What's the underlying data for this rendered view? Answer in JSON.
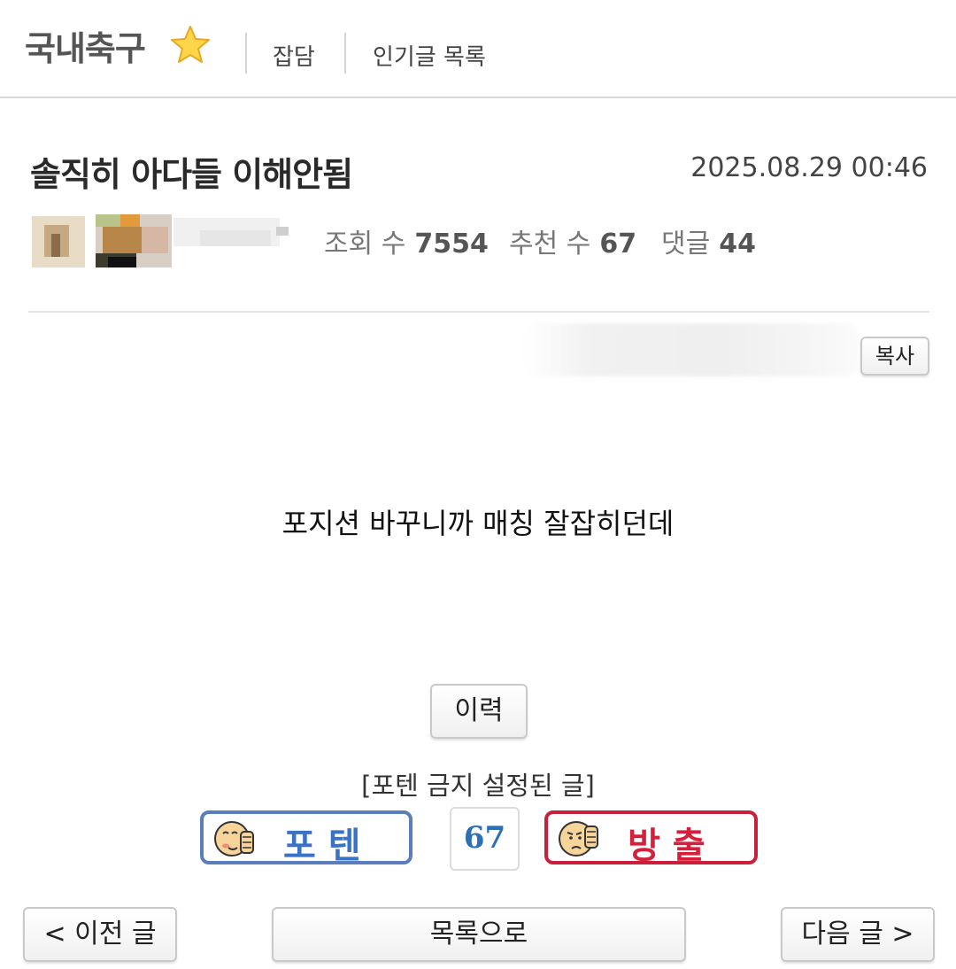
{
  "header": {
    "board_title": "국내축구",
    "nav": [
      "잡담",
      "인기글 목록"
    ]
  },
  "post": {
    "title": "솔직히 아다들 이해안됨",
    "date": "2025.08.29 00:46",
    "stats": {
      "views_label": "조회 수",
      "views": "7554",
      "recommend_label": "추천 수",
      "recommend": "67",
      "comments_label": "댓글",
      "comments": "44"
    },
    "copy_label": "복사",
    "body": "포지션 바꾸니까 매칭 잘잡히던데"
  },
  "actions": {
    "history_label": "이력",
    "ban_note": "[포텐 금지 설정된 글]",
    "upvote_label": "포텐",
    "vote_count": "67",
    "downvote_label": "방출",
    "prev_label": "< 이전 글",
    "list_label": "목록으로",
    "next_label": "다음 글 >"
  },
  "colors": {
    "upvote": "#3a72c7",
    "downvote": "#d61f3a",
    "count": "#2b6fb5"
  }
}
